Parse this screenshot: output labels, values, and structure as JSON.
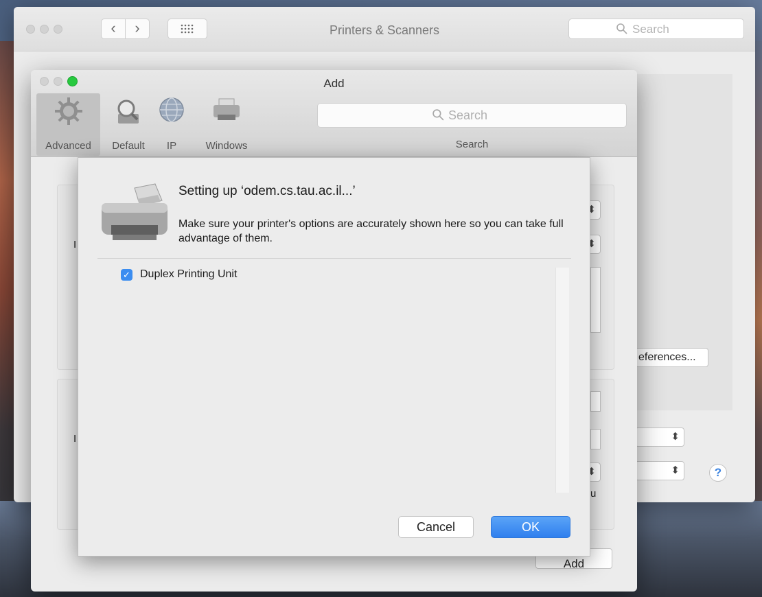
{
  "main_window": {
    "title": "Printers & Scanners",
    "search_placeholder": "Search",
    "references_label": "eferences...",
    "cut_text_u": "u",
    "help_label": "?"
  },
  "add_window": {
    "title": "Add",
    "toolbar": [
      {
        "label": "Advanced",
        "icon": "gear-icon",
        "selected": true
      },
      {
        "label": "Default",
        "icon": "magnifier-printer-icon",
        "selected": false
      },
      {
        "label": "IP",
        "icon": "globe-icon",
        "selected": false
      },
      {
        "label": "Windows",
        "icon": "printer-icon",
        "selected": false
      }
    ],
    "search_placeholder": "Search",
    "search_label": "Search",
    "add_button": "Add",
    "cut_letter_1": "I",
    "cut_letter_2": "I"
  },
  "sheet": {
    "title": "Setting up ‘odem.cs.tau.ac.il...’",
    "description": "Make sure your printer's options are accurately shown here so you can take full advantage of them.",
    "options": [
      {
        "label": "Duplex Printing Unit",
        "checked": true
      }
    ],
    "cancel_button": "Cancel",
    "ok_button": "OK"
  },
  "colors": {
    "accent": "#3b8df0",
    "close": "#d2d2d2",
    "zoom_green": "#27c93f"
  }
}
